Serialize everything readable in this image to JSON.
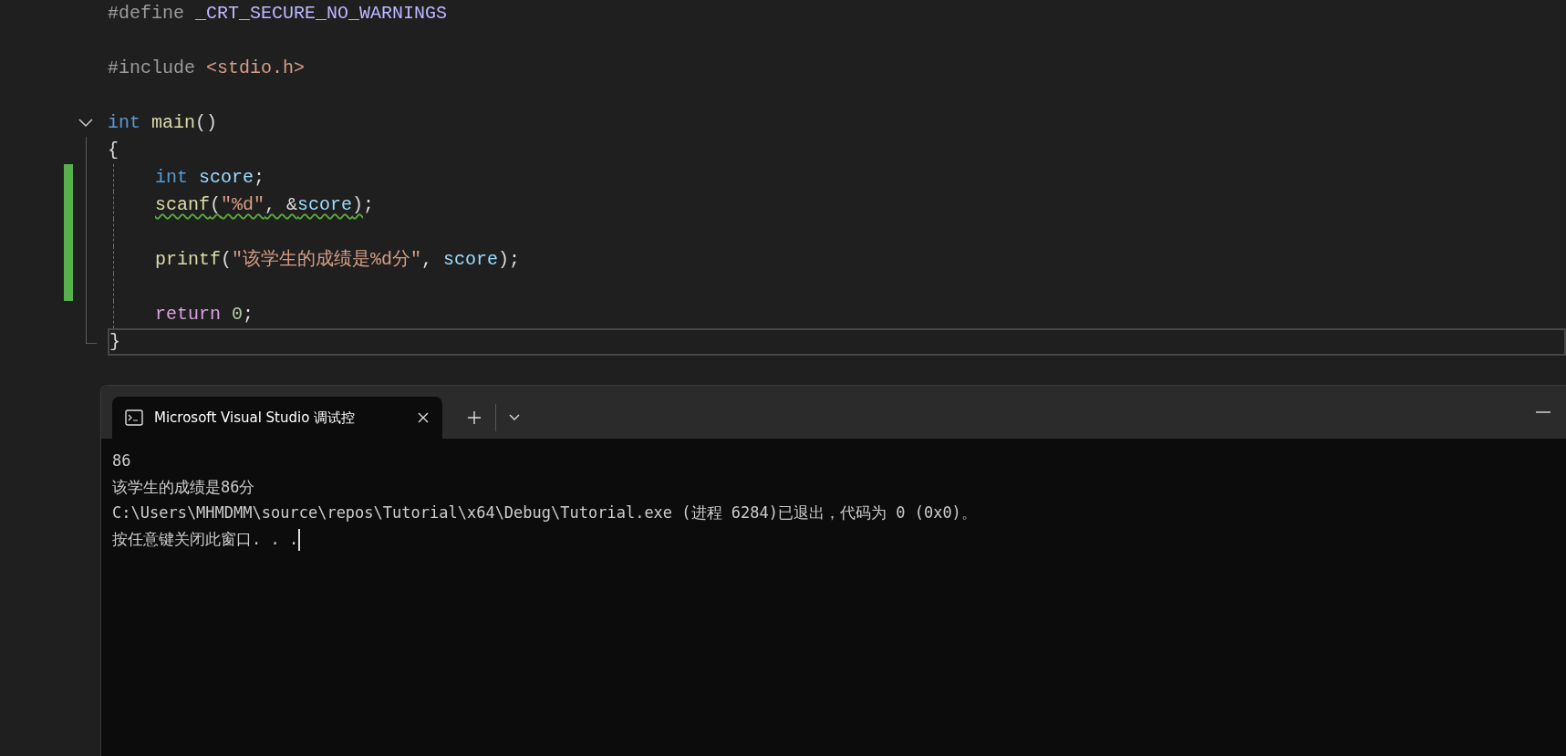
{
  "editor": {
    "lines": [
      {
        "changed": false,
        "tokens": [
          {
            "text": "#define ",
            "kind": "preproc"
          },
          {
            "text": "_CRT_SECURE_NO_WARNINGS",
            "kind": "macro"
          }
        ]
      },
      {
        "changed": false
      },
      {
        "changed": false,
        "tokens": [
          {
            "text": "#include ",
            "kind": "preproc"
          },
          {
            "text": "<stdio.h>",
            "kind": "string"
          }
        ]
      },
      {
        "changed": false
      },
      {
        "kind": "fold",
        "expanded": true,
        "changed": false,
        "tokens": [
          {
            "text": "int ",
            "kind": "keyword"
          },
          {
            "text": "main",
            "kind": "function"
          },
          {
            "text": "()",
            "kind": "plain"
          }
        ],
        "body": [
          {
            "changed": false,
            "tokens": [
              {
                "text": "{",
                "kind": "plain"
              }
            ],
            "children": [
              {
                "changed": true,
                "tokens": [
                  {
                    "text": "int ",
                    "kind": "keyword"
                  },
                  {
                    "text": "score",
                    "kind": "variable"
                  },
                  {
                    "text": ";",
                    "kind": "plain"
                  }
                ]
              },
              {
                "changed": true,
                "tokens": [
                  {
                    "warning": true,
                    "tokens": [
                      {
                        "text": "scanf",
                        "kind": "function"
                      },
                      {
                        "text": "(",
                        "kind": "plain"
                      },
                      {
                        "text": "\"%d\"",
                        "kind": "string"
                      },
                      {
                        "text": ", &",
                        "kind": "plain"
                      },
                      {
                        "text": "score",
                        "kind": "variable"
                      },
                      {
                        "text": ")",
                        "kind": "plain"
                      }
                    ]
                  },
                  {
                    "text": ";",
                    "kind": "plain"
                  }
                ]
              },
              {
                "changed": true
              },
              {
                "changed": true,
                "tokens": [
                  {
                    "text": "printf",
                    "kind": "function"
                  },
                  {
                    "text": "(",
                    "kind": "plain"
                  },
                  {
                    "text": "\"该学生的成绩是%d分\"",
                    "kind": "string"
                  },
                  {
                    "text": ", ",
                    "kind": "plain"
                  },
                  {
                    "text": "score",
                    "kind": "variable"
                  },
                  {
                    "text": ");",
                    "kind": "plain"
                  }
                ]
              },
              {
                "changed": true
              },
              {
                "changed": false,
                "tokens": [
                  {
                    "text": "return ",
                    "kind": "control"
                  },
                  {
                    "text": "0",
                    "kind": "number"
                  },
                  {
                    "text": ";",
                    "kind": "plain"
                  }
                ]
              }
            ]
          },
          {
            "changed": false,
            "current": true,
            "tokens": [
              {
                "text": "}",
                "kind": "plain"
              }
            ]
          }
        ]
      }
    ]
  },
  "terminal": {
    "tab_title": "Microsoft Visual Studio 调试控",
    "tab_selected": true,
    "output": [
      {
        "text": "86"
      },
      {
        "text": "该学生的成绩是86分"
      },
      {
        "text": "C:\\Users\\MHMDMM\\source\\repos\\Tutorial\\x64\\Debug\\Tutorial.exe (进程 6284)已退出，代码为 0 (0x0)。"
      },
      {
        "text": "按任意键关闭此窗口. . .",
        "cursor": true
      }
    ]
  }
}
